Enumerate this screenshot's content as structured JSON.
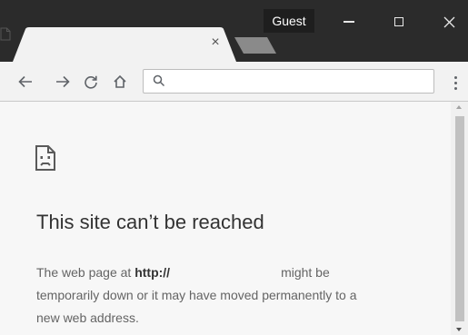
{
  "window": {
    "profile_badge": "Guest",
    "controls": [
      "minimize-icon",
      "maximize-icon",
      "close-icon"
    ]
  },
  "tab": {
    "title": "",
    "icon": "page-icon",
    "close_glyph": "×"
  },
  "toolbar": {
    "back_glyph": "←",
    "forward_glyph": "→",
    "reload_glyph": "C",
    "home_icon": "home-icon",
    "omnibox_value": "",
    "omnibox_placeholder": "",
    "menu_icon": "kebab-menu-icon"
  },
  "error": {
    "icon": "sad-page-icon",
    "title": "This site can’t be reached",
    "text_prefix": "The web page at",
    "url_bold": "http://",
    "text_after_url": "might be",
    "line2": "temporarily down or it may have moved permanently to a",
    "line3": "new web address."
  },
  "colors": {
    "titlebar": "#2b2b2b",
    "toolbar": "#f2f2f2",
    "content_bg": "#f7f7f7",
    "title_text": "#333333",
    "body_text": "#646464"
  }
}
